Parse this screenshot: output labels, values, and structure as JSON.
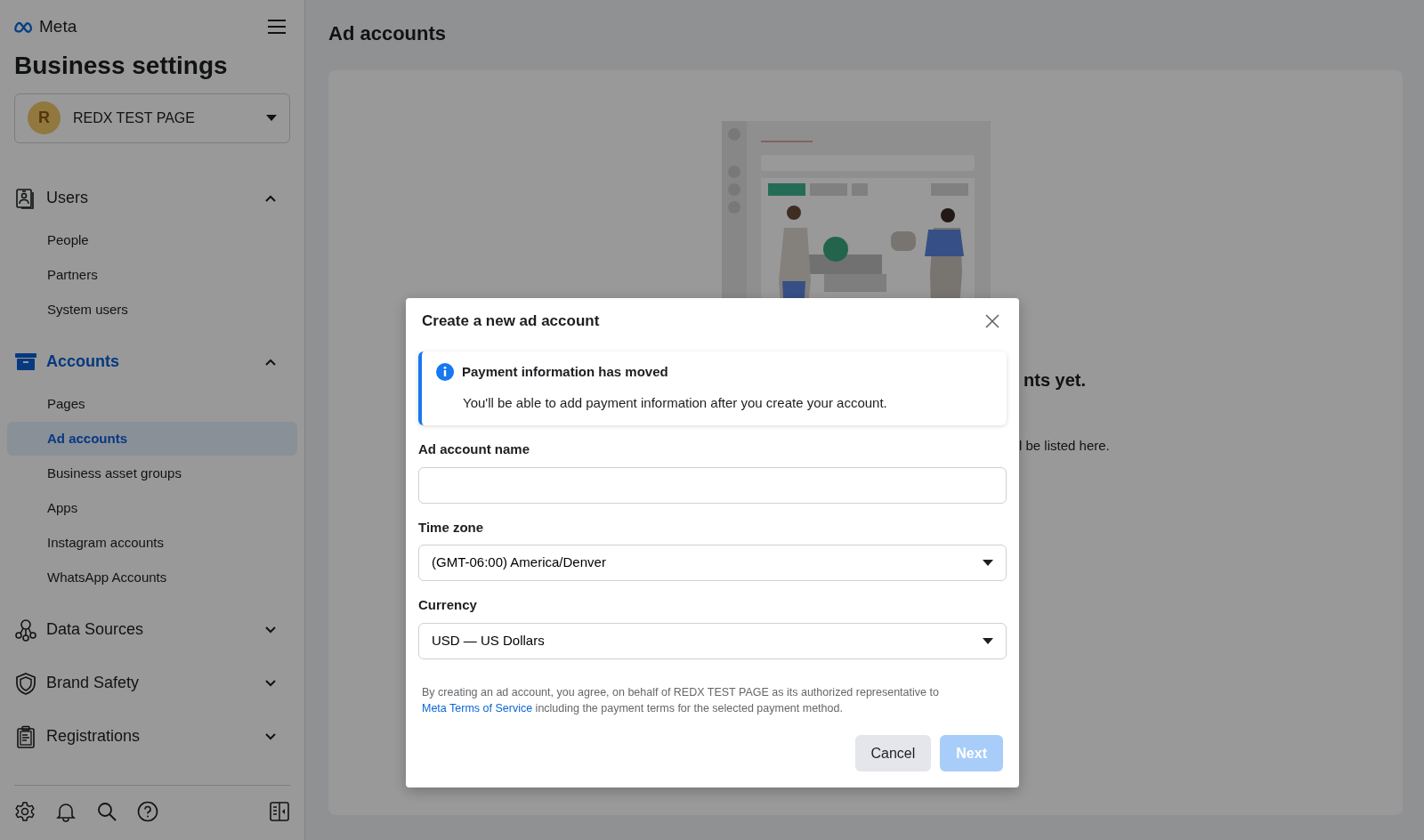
{
  "sidebar": {
    "brand": "Meta",
    "title": "Business settings",
    "account": {
      "initial": "R",
      "name": "REDX TEST PAGE"
    },
    "sections": [
      {
        "kind": "users",
        "label": "Users",
        "expanded": true,
        "selected": false,
        "children": [
          {
            "label": "People",
            "selected": false
          },
          {
            "label": "Partners",
            "selected": false
          },
          {
            "label": "System users",
            "selected": false
          }
        ]
      },
      {
        "kind": "accounts",
        "label": "Accounts",
        "expanded": true,
        "selected": true,
        "children": [
          {
            "label": "Pages",
            "selected": false
          },
          {
            "label": "Ad accounts",
            "selected": true
          },
          {
            "label": "Business asset groups",
            "selected": false
          },
          {
            "label": "Apps",
            "selected": false
          },
          {
            "label": "Instagram accounts",
            "selected": false
          },
          {
            "label": "WhatsApp Accounts",
            "selected": false
          }
        ]
      },
      {
        "kind": "data",
        "label": "Data Sources",
        "expanded": false,
        "selected": false
      },
      {
        "kind": "shield",
        "label": "Brand Safety",
        "expanded": false,
        "selected": false
      },
      {
        "kind": "clipboard",
        "label": "Registrations",
        "expanded": false,
        "selected": false
      }
    ]
  },
  "page": {
    "title": "Ad accounts",
    "empty_heading": "nts yet.",
    "empty_text": "l be listed here."
  },
  "dialog": {
    "title": "Create a new ad account",
    "notice": {
      "title": "Payment information has moved",
      "text": "You'll be able to add payment information after you create your account."
    },
    "fields": [
      {
        "kind": "text",
        "label": "Ad account name"
      },
      {
        "kind": "select",
        "label": "Time zone",
        "value": "(GMT-06:00) America/Denver"
      },
      {
        "kind": "select",
        "label": "Currency",
        "value": "USD — US Dollars"
      }
    ],
    "legal": {
      "before": "By creating an ad account, you agree, on behalf of REDX TEST PAGE as its authorized representative to",
      "link": "Meta Terms of Service",
      "after": "including the payment terms for the selected payment method."
    },
    "buttons": [
      {
        "label": "Cancel",
        "kind": "secondary",
        "disabled": false
      },
      {
        "label": "Next",
        "kind": "primary",
        "disabled": true
      }
    ]
  }
}
